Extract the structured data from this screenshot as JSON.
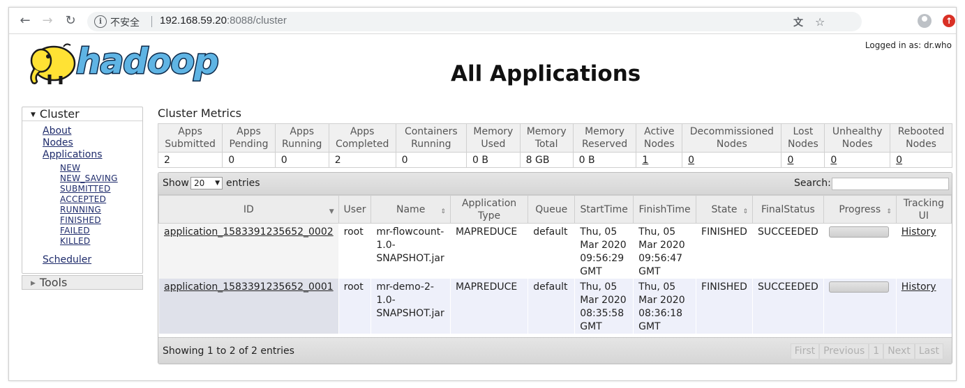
{
  "browser": {
    "insecure_label": "不安全",
    "url_host": "192.168.59.20",
    "url_rest": ":8088/cluster"
  },
  "header": {
    "logged_in": "Logged in as: dr.who",
    "logo_text": "hadoop",
    "title": "All Applications"
  },
  "sidebar": {
    "cluster_label": "Cluster",
    "links": [
      "About",
      "Nodes",
      "Applications"
    ],
    "states": [
      "NEW",
      "NEW_SAVING",
      "SUBMITTED",
      "ACCEPTED",
      "RUNNING",
      "FINISHED",
      "FAILED",
      "KILLED"
    ],
    "scheduler": "Scheduler",
    "tools_label": "Tools"
  },
  "metrics": {
    "title": "Cluster Metrics",
    "headers": [
      "Apps Submitted",
      "Apps Pending",
      "Apps Running",
      "Apps Completed",
      "Containers Running",
      "Memory Used",
      "Memory Total",
      "Memory Reserved",
      "Active Nodes",
      "Decommissioned Nodes",
      "Lost Nodes",
      "Unhealthy Nodes",
      "Rebooted Nodes"
    ],
    "values": [
      "2",
      "0",
      "0",
      "2",
      "0",
      "0 B",
      "8 GB",
      "0 B",
      "1",
      "0",
      "0",
      "0",
      "0"
    ]
  },
  "apps": {
    "show_label": "Show",
    "page_size": "20",
    "entries_label": "entries",
    "search_label": "Search:",
    "headers": [
      "ID",
      "User",
      "Name",
      "Application Type",
      "Queue",
      "StartTime",
      "FinishTime",
      "State",
      "FinalStatus",
      "Progress",
      "Tracking UI"
    ],
    "rows": [
      {
        "id": "application_1583391235652_0002",
        "user": "root",
        "name": "mr-flowcount-1.0-SNAPSHOT.jar",
        "type": "MAPREDUCE",
        "queue": "default",
        "start": "Thu, 05 Mar 2020 09:56:29 GMT",
        "finish": "Thu, 05 Mar 2020 09:56:47 GMT",
        "state": "FINISHED",
        "final_status": "SUCCEEDED",
        "progress": 1.0,
        "tracking": "History"
      },
      {
        "id": "application_1583391235652_0001",
        "user": "root",
        "name": "mr-demo-2-1.0-SNAPSHOT.jar",
        "type": "MAPREDUCE",
        "queue": "default",
        "start": "Thu, 05 Mar 2020 08:35:58 GMT",
        "finish": "Thu, 05 Mar 2020 08:36:18 GMT",
        "state": "FINISHED",
        "final_status": "SUCCEEDED",
        "progress": 1.0,
        "tracking": "History"
      }
    ],
    "showing": "Showing 1 to 2 of 2 entries",
    "pager": [
      "First",
      "Previous",
      "1",
      "Next",
      "Last"
    ]
  }
}
